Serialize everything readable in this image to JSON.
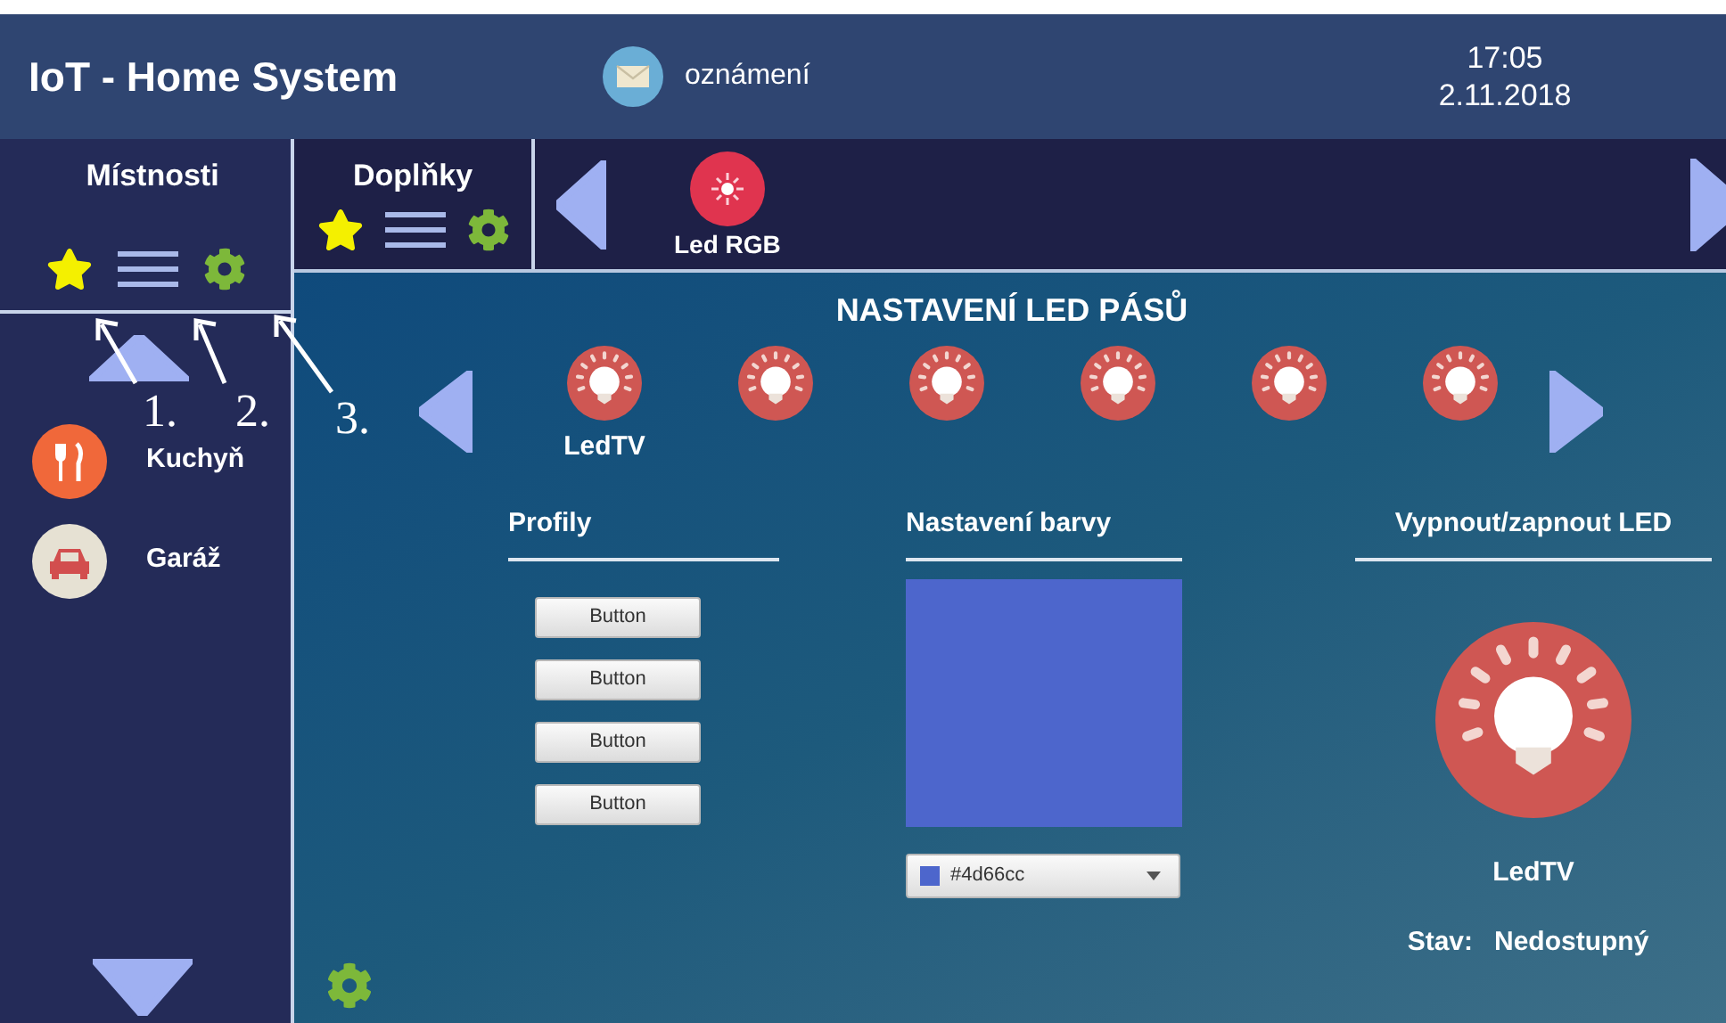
{
  "header": {
    "title": "IoT - Home System",
    "notifications": "oznámení",
    "time": "17:05",
    "date": "2.11.2018"
  },
  "sidebar": {
    "title": "Místnosti",
    "rooms": [
      {
        "label": "Kuchyň",
        "kind": "kitchen"
      },
      {
        "label": "Garáž",
        "kind": "garage"
      }
    ]
  },
  "addons": {
    "title": "Doplňky"
  },
  "devices": [
    {
      "label": "Led RGB"
    }
  ],
  "main": {
    "title": "NASTAVENÍ LED PÁSŮ",
    "strips": [
      {
        "kind": "bulb",
        "label": "LedTV"
      },
      {
        "kind": "bulb"
      },
      {
        "kind": "bulb"
      },
      {
        "kind": "bulb"
      },
      {
        "kind": "bulb"
      },
      {
        "kind": "bulb"
      }
    ],
    "profiles": {
      "title": "Profily",
      "buttons": [
        "Button",
        "Button",
        "Button",
        "Button"
      ]
    },
    "color": {
      "title": "Nastavení barvy",
      "value": "#4d66cc"
    },
    "power": {
      "title": "Vypnout/zapnout LED",
      "device": "LedTV",
      "status_label": "Stav:",
      "status": "Nedostupný"
    }
  },
  "annotations": [
    "1.",
    "2.",
    "3."
  ]
}
